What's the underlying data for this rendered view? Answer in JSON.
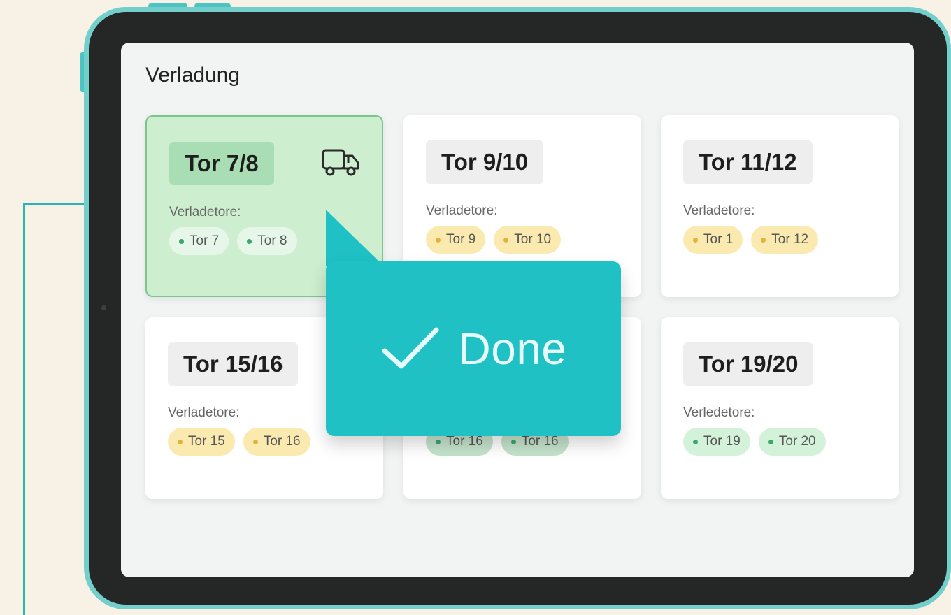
{
  "page": {
    "title": "Verladung"
  },
  "cards": [
    {
      "title": "Tor 7/8",
      "label": "Verladetore:",
      "active": true,
      "chips": [
        {
          "text": "Tor 7",
          "color": "green"
        },
        {
          "text": "Tor 8",
          "color": "green"
        }
      ]
    },
    {
      "title": "Tor 9/10",
      "label": "Verladetore:",
      "chips": [
        {
          "text": "Tor 9",
          "color": "yellow"
        },
        {
          "text": "Tor 10",
          "color": "yellow"
        }
      ]
    },
    {
      "title": "Tor 11/12",
      "label": "Verladetore:",
      "chips": [
        {
          "text": "Tor 1",
          "color": "yellow"
        },
        {
          "text": "Tor 12",
          "color": "yellow"
        }
      ]
    },
    {
      "title": "Tor 15/16",
      "label": "Verladetore:",
      "chips": [
        {
          "text": "Tor 15",
          "color": "yellow"
        },
        {
          "text": "Tor 16",
          "color": "yellow"
        }
      ]
    },
    {
      "title": "",
      "label": "",
      "chips": [
        {
          "text": "Tor 16",
          "color": "green"
        },
        {
          "text": "Tor 16",
          "color": "green"
        }
      ]
    },
    {
      "title": "Tor 19/20",
      "label": "Verledetore:",
      "chips": [
        {
          "text": "Tor 19",
          "color": "green"
        },
        {
          "text": "Tor 20",
          "color": "green"
        }
      ]
    }
  ],
  "popover": {
    "text": "Done",
    "icon": "checkmark-icon"
  },
  "colors": {
    "accent": "#1fc1c5",
    "active_card": "#cdeecf",
    "chip_yellow": "#fbeab0",
    "chip_green": "#d4f1da"
  },
  "icons": {
    "truck": "truck-icon"
  }
}
